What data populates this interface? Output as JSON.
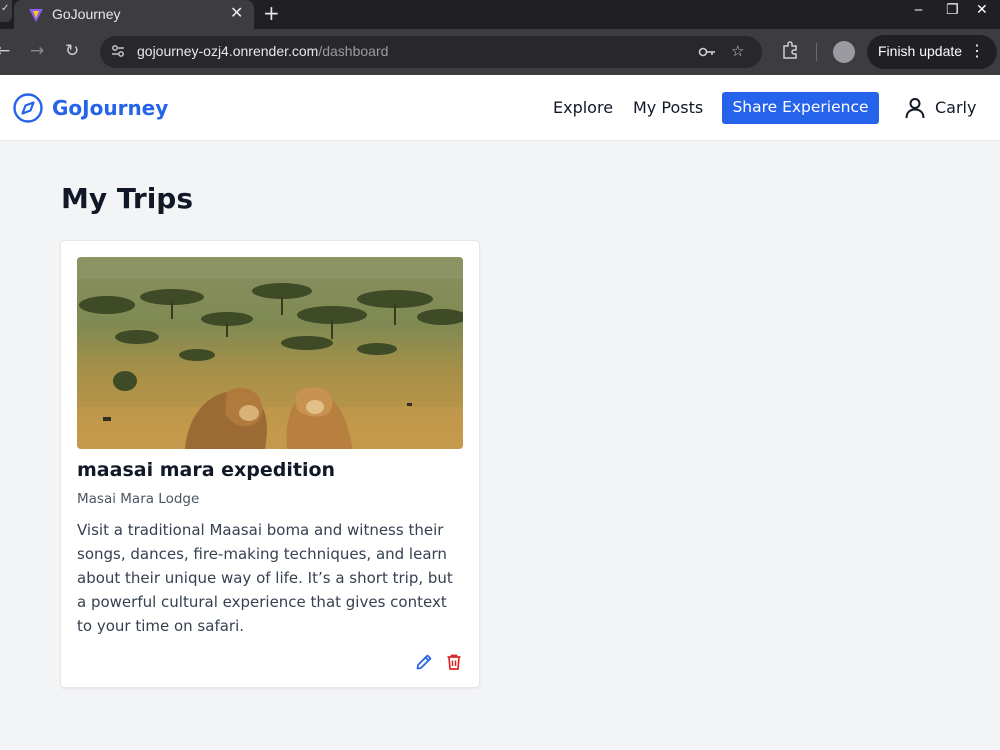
{
  "browser": {
    "tab_title": "GoJourney",
    "tab_close": "✕",
    "new_tab": "+",
    "url_host": "gojourney-ozj4.onrender.com",
    "url_path": "/dashboard",
    "finish_update": "Finish update",
    "menu_dots": "⋮"
  },
  "navbar": {
    "brand": "GoJourney",
    "links": [
      "Explore",
      "My Posts"
    ],
    "share_button": "Share Experience",
    "user": "Carly"
  },
  "main": {
    "title": "My Trips",
    "trips": [
      {
        "title": "maasai mara expedition",
        "location": "Masai Mara Lodge",
        "description": "Visit a traditional Maasai boma and witness their songs, dances, fire-making techniques, and learn about their unique way of life. It’s a short trip, but a powerful cultural experience that gives context to your time on safari."
      }
    ]
  },
  "colors": {
    "brand": "#2563eb",
    "danger": "#dc2626",
    "background": "#f3f4f6"
  },
  "icons": [
    "compass-icon",
    "user-icon",
    "pencil-icon",
    "trash-icon",
    "star-icon",
    "key-icon",
    "puzzle-icon"
  ]
}
